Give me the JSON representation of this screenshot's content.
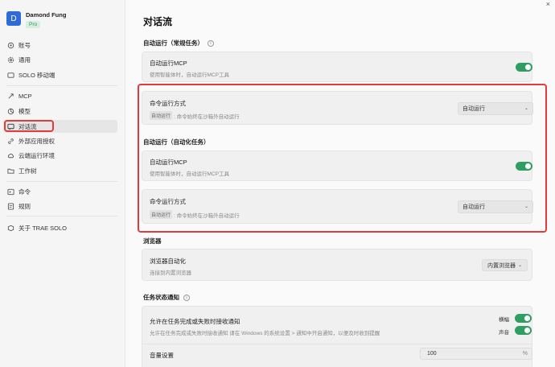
{
  "profile": {
    "initial": "D",
    "name": "Damond Fung",
    "plan": "Pro"
  },
  "sidebar": {
    "items": [
      {
        "label": "账号",
        "icon": "settings-icon"
      },
      {
        "label": "通用",
        "icon": "gear-icon"
      },
      {
        "label": "SOLO 移动端",
        "icon": "mobile-icon"
      },
      {
        "label": "MCP",
        "icon": "mcp-icon"
      },
      {
        "label": "模型",
        "icon": "cube-icon"
      },
      {
        "label": "对话流",
        "icon": "chat-icon"
      },
      {
        "label": "外部应用授权",
        "icon": "link-icon"
      },
      {
        "label": "云端运行环境",
        "icon": "cloud-icon"
      },
      {
        "label": "工作树",
        "icon": "folder-icon"
      },
      {
        "label": "命令",
        "icon": "command-icon"
      },
      {
        "label": "规则",
        "icon": "rules-icon"
      },
      {
        "label": "关于 TRAE SOLO",
        "icon": "about-icon"
      }
    ]
  },
  "page": {
    "title": "对话流",
    "close": "×"
  },
  "sections": {
    "auto_normal": "自动运行（常规任务）",
    "auto_task": "自动运行（自动化任务）",
    "browser": "浏览器",
    "notify": "任务状态通知",
    "info_glyph": "i"
  },
  "cards": {
    "mcp1": {
      "title": "自动运行MCP",
      "desc": "使用智能体时，自动运行MCP工具"
    },
    "cmd1": {
      "title": "命令运行方式",
      "tag": "自动运行",
      "desc": ": 命令始终在沙箱外自动运行",
      "select": "自动运行"
    },
    "mcp2": {
      "title": "自动运行MCP",
      "desc": "使用智能体时，自动运行MCP工具"
    },
    "cmd2": {
      "title": "命令运行方式",
      "tag": "自动运行",
      "desc": ": 命令始终在沙箱外自动运行",
      "select": "自动运行"
    },
    "browser": {
      "title": "浏览器自动化",
      "desc": "连接到内置浏览器",
      "select": "内置浏览器"
    },
    "notify": {
      "title": "允许在任务完成或失败时接收通知",
      "desc": "允许在任务完成或失败时接收通知 请在 Windows 的系统设置 > 通知中开启通知，以便及时收到提醒",
      "banner": "横幅",
      "sound": "声音",
      "volume_label": "音量设置",
      "volume_value": "100",
      "volume_unit": "%"
    }
  },
  "colors": {
    "accent_green": "#2e9e63",
    "highlight_red": "#e03c3c",
    "avatar_blue": "#2f6bd8"
  }
}
